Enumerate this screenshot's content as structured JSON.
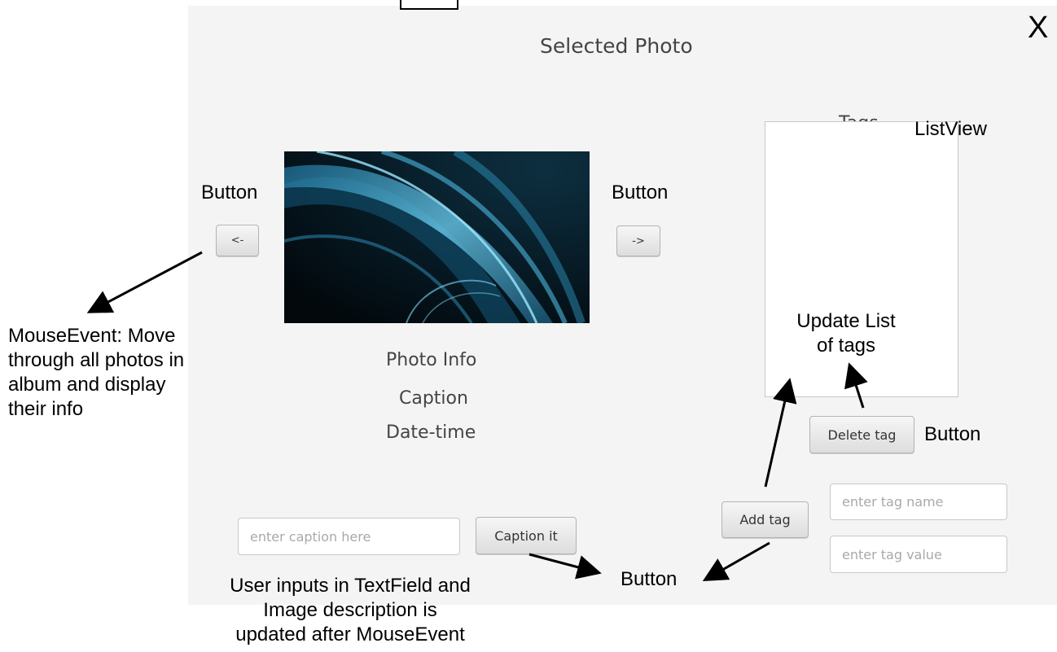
{
  "window": {
    "title": "Selected Photo",
    "close_label": "X"
  },
  "navigation": {
    "prev_label": "<-",
    "next_label": "->"
  },
  "photo_info": {
    "heading": "Photo Info",
    "caption": "Caption",
    "datetime": "Date-time"
  },
  "tags": {
    "heading": "Tags",
    "delete_label": "Delete tag",
    "add_label": "Add tag",
    "name_placeholder": "enter tag name",
    "value_placeholder": "enter tag value"
  },
  "caption_form": {
    "placeholder": "enter caption here",
    "submit_label": "Caption it"
  },
  "annotations": {
    "button_prev": "Button",
    "button_next": "Button",
    "listview": "ListView",
    "button_delete": "Button",
    "button_bottom": "Button",
    "mouse_event_line1": "MouseEvent: Move",
    "mouse_event_line2": "through all photos in",
    "mouse_event_line3": "album and display",
    "mouse_event_line4": "their info",
    "update_line1": "Update List",
    "update_line2": "of tags",
    "textfield_line1": "User inputs in TextField and",
    "textfield_line2": "Image description is",
    "textfield_line3": "updated after MouseEvent"
  },
  "colors": {
    "panel_bg": "#f4f4f4",
    "label_text": "#444444",
    "placeholder_text": "#a9a9a9"
  }
}
